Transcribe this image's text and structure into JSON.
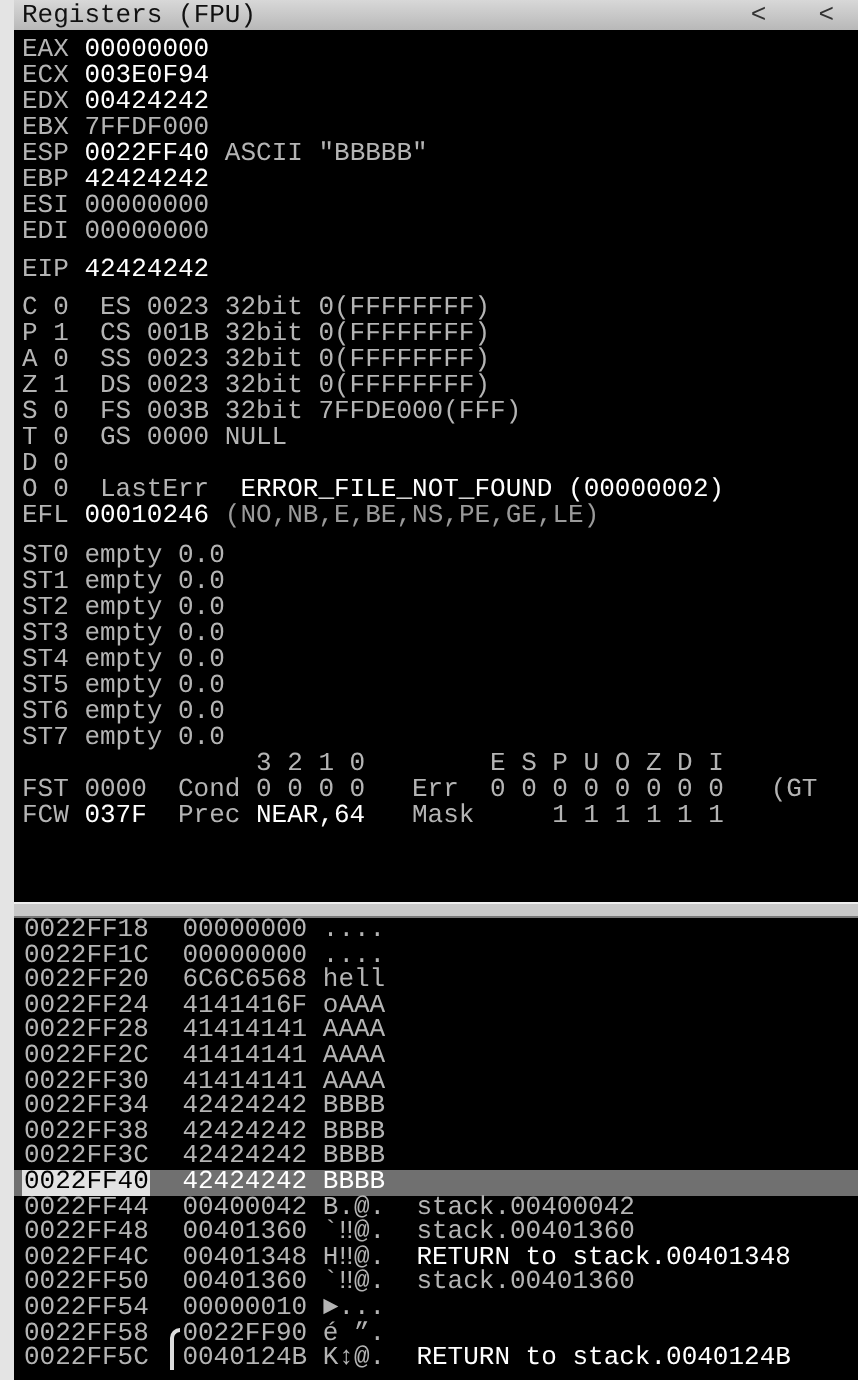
{
  "panel": {
    "title": "Registers (FPU)",
    "nav_buttons": [
      "<",
      "<"
    ]
  },
  "registers": [
    {
      "name": "EAX",
      "value": "00000000",
      "changed": true
    },
    {
      "name": "ECX",
      "value": "003E0F94",
      "changed": true
    },
    {
      "name": "EDX",
      "value": "00424242",
      "changed": true
    },
    {
      "name": "EBX",
      "value": "7FFDF000",
      "changed": false
    },
    {
      "name": "ESP",
      "value": "0022FF40",
      "changed": true,
      "comment": "ASCII \"BBBBB\""
    },
    {
      "name": "EBP",
      "value": "42424242",
      "changed": true
    },
    {
      "name": "ESI",
      "value": "00000000",
      "changed": false
    },
    {
      "name": "EDI",
      "value": "00000000",
      "changed": false
    }
  ],
  "eip": {
    "name": "EIP",
    "value": "42424242",
    "changed": true
  },
  "flags": [
    {
      "name": "C",
      "value": "0"
    },
    {
      "name": "P",
      "value": "1"
    },
    {
      "name": "A",
      "value": "0"
    },
    {
      "name": "Z",
      "value": "1"
    },
    {
      "name": "S",
      "value": "0"
    },
    {
      "name": "T",
      "value": "0"
    },
    {
      "name": "D",
      "value": "0"
    },
    {
      "name": "O",
      "value": "0"
    }
  ],
  "segments": [
    {
      "name": "ES",
      "selector": "0023",
      "info": "32bit 0(FFFFFFFF)"
    },
    {
      "name": "CS",
      "selector": "001B",
      "info": "32bit 0(FFFFFFFF)"
    },
    {
      "name": "SS",
      "selector": "0023",
      "info": "32bit 0(FFFFFFFF)"
    },
    {
      "name": "DS",
      "selector": "0023",
      "info": "32bit 0(FFFFFFFF)"
    },
    {
      "name": "FS",
      "selector": "003B",
      "info": "32bit 7FFDE000(FFF)"
    },
    {
      "name": "GS",
      "selector": "0000",
      "info": "NULL"
    }
  ],
  "last_error": {
    "label": "LastErr",
    "value": "ERROR_FILE_NOT_FOUND (00000002)"
  },
  "efl": {
    "label": "EFL",
    "value": "00010246",
    "flags": "(NO,NB,E,BE,NS,PE,GE,LE)"
  },
  "fpu_stack": [
    {
      "name": "ST0",
      "tag": "empty",
      "value": "0.0"
    },
    {
      "name": "ST1",
      "tag": "empty",
      "value": "0.0"
    },
    {
      "name": "ST2",
      "tag": "empty",
      "value": "0.0"
    },
    {
      "name": "ST3",
      "tag": "empty",
      "value": "0.0"
    },
    {
      "name": "ST4",
      "tag": "empty",
      "value": "0.0"
    },
    {
      "name": "ST5",
      "tag": "empty",
      "value": "0.0"
    },
    {
      "name": "ST6",
      "tag": "empty",
      "value": "0.0"
    },
    {
      "name": "ST7",
      "tag": "empty",
      "value": "0.0"
    }
  ],
  "fst": {
    "label": "FST",
    "value": "0000",
    "cond_label": "Cond",
    "cond_headers": [
      "3",
      "2",
      "1",
      "0"
    ],
    "cond_values": [
      "0",
      "0",
      "0",
      "0"
    ],
    "err_label": "Err",
    "err_headers": [
      "E",
      "S",
      "P",
      "U",
      "O",
      "Z",
      "D",
      "I"
    ],
    "err_values": [
      "0",
      "0",
      "0",
      "0",
      "0",
      "0",
      "0",
      "0"
    ],
    "extra": "(GT"
  },
  "fcw": {
    "label": "FCW",
    "value": "037F",
    "prec_label": "Prec",
    "prec_value": "NEAR,64",
    "mask_label": "Mask",
    "mask_values": [
      "1",
      "1",
      "1",
      "1",
      "1",
      "1"
    ]
  },
  "stack": [
    {
      "address": "0022FF18",
      "value": "00000000",
      "ascii": "....",
      "selected": false,
      "frame_start": false
    },
    {
      "address": "0022FF1C",
      "value": "00000000",
      "ascii": "....",
      "selected": false,
      "frame_start": false
    },
    {
      "address": "0022FF20",
      "value": "6C6C6568",
      "ascii": "hell",
      "selected": false,
      "frame_start": false
    },
    {
      "address": "0022FF24",
      "value": "4141416F",
      "ascii": "oAAA",
      "selected": false,
      "frame_start": false
    },
    {
      "address": "0022FF28",
      "value": "41414141",
      "ascii": "AAAA",
      "selected": false,
      "frame_start": false
    },
    {
      "address": "0022FF2C",
      "value": "41414141",
      "ascii": "AAAA",
      "selected": false,
      "frame_start": false
    },
    {
      "address": "0022FF30",
      "value": "41414141",
      "ascii": "AAAA",
      "selected": false,
      "frame_start": false
    },
    {
      "address": "0022FF34",
      "value": "42424242",
      "ascii": "BBBB",
      "selected": false,
      "frame_start": false
    },
    {
      "address": "0022FF38",
      "value": "42424242",
      "ascii": "BBBB",
      "selected": false,
      "frame_start": false
    },
    {
      "address": "0022FF3C",
      "value": "42424242",
      "ascii": "BBBB",
      "selected": false,
      "frame_start": false
    },
    {
      "address": "0022FF40",
      "value": "42424242",
      "ascii": "BBBB",
      "selected": true,
      "frame_start": false
    },
    {
      "address": "0022FF44",
      "value": "00400042",
      "ascii": "B.@.",
      "selected": false,
      "frame_start": false,
      "comment": {
        "text": "stack.00400042",
        "kind": "plain"
      }
    },
    {
      "address": "0022FF48",
      "value": "00401360",
      "ascii": "`‼@.",
      "selected": false,
      "frame_start": false,
      "comment": {
        "text": "stack.00401360",
        "kind": "plain"
      }
    },
    {
      "address": "0022FF4C",
      "value": "00401348",
      "ascii": "H‼@.",
      "selected": false,
      "frame_start": false,
      "comment": {
        "text": "RETURN to stack.00401348",
        "kind": "return"
      }
    },
    {
      "address": "0022FF50",
      "value": "00401360",
      "ascii": "`‼@.",
      "selected": false,
      "frame_start": false,
      "comment": {
        "text": "stack.00401360",
        "kind": "plain"
      }
    },
    {
      "address": "0022FF54",
      "value": "00000010",
      "ascii": "►...",
      "selected": false,
      "frame_start": false
    },
    {
      "address": "0022FF58",
      "value": "0022FF90",
      "ascii": "é ”.",
      "selected": false,
      "frame_start": true
    },
    {
      "address": "0022FF5C",
      "value": "0040124B",
      "ascii": "K↕@.",
      "selected": false,
      "frame_start": false,
      "comment": {
        "text": "RETURN to stack.0040124B",
        "kind": "return"
      }
    }
  ]
}
